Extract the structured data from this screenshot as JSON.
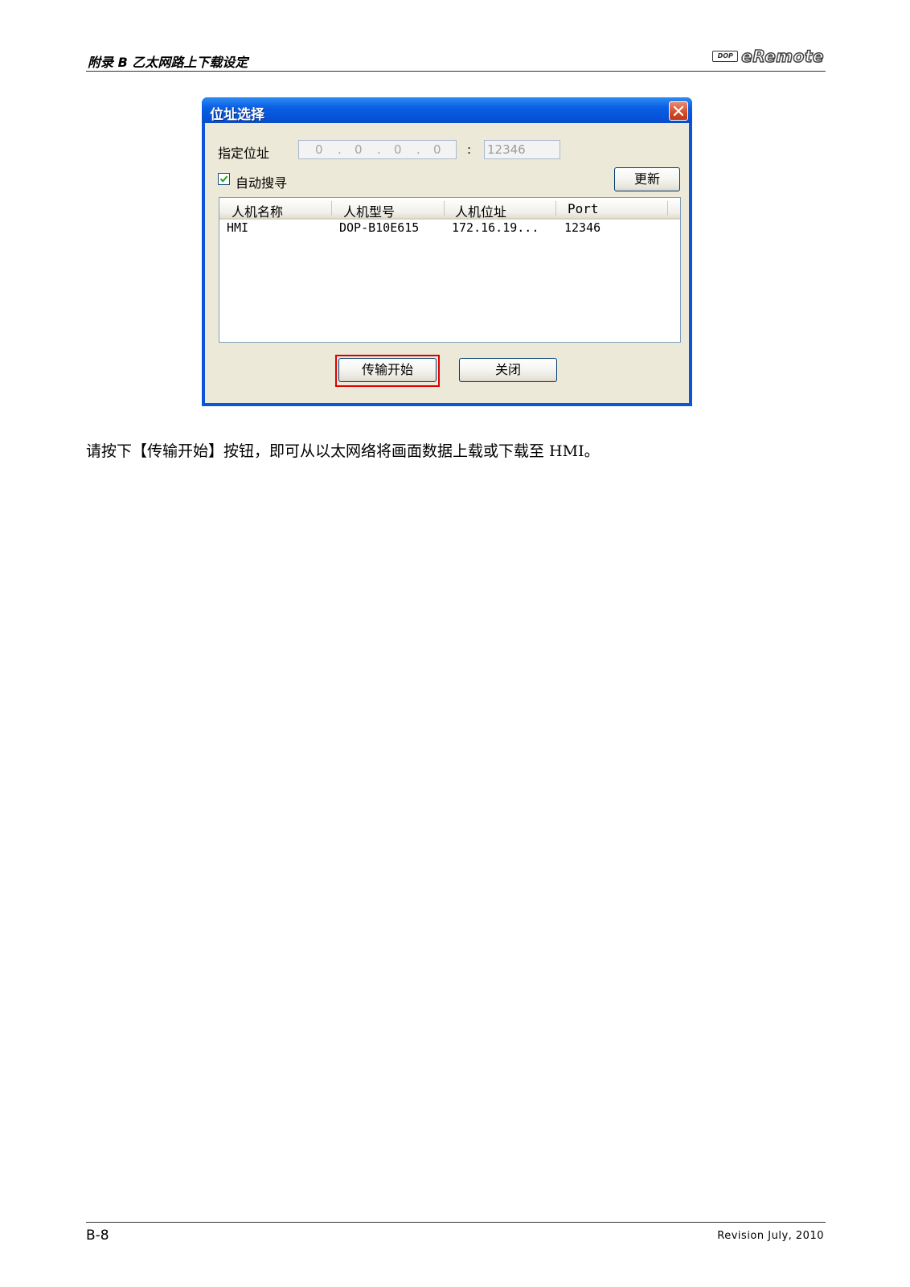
{
  "header": {
    "title": "附录 B 乙太网路上下载设定",
    "logo_badge": "DOP",
    "logo_text": "eRemote"
  },
  "dialog": {
    "title": "位址选择",
    "address_label": "指定位址",
    "ip_segments": [
      "0",
      "0",
      "0",
      "0"
    ],
    "colon": ":",
    "port_value": "12346",
    "auto_search_label": "自动搜寻",
    "auto_search_checked": true,
    "refresh_button": "更新",
    "columns": [
      "人机名称",
      "人机型号",
      "人机位址",
      "Port"
    ],
    "rows": [
      {
        "name": "HMI",
        "model": "DOP-B10E615",
        "address": "172.16.19...",
        "port": "12346"
      }
    ],
    "start_button": "传输开始",
    "close_button": "关闭"
  },
  "body": {
    "text": "请按下【传输开始】按钮，即可从以太网络将画面数据上载或下载至 HMI。"
  },
  "footer": {
    "page": "B-8",
    "revision": "Revision July, 2010"
  },
  "colors": {
    "highlight": "#e00000",
    "titlebar": "#0a55d8",
    "dialog_face": "#ece9d8"
  }
}
